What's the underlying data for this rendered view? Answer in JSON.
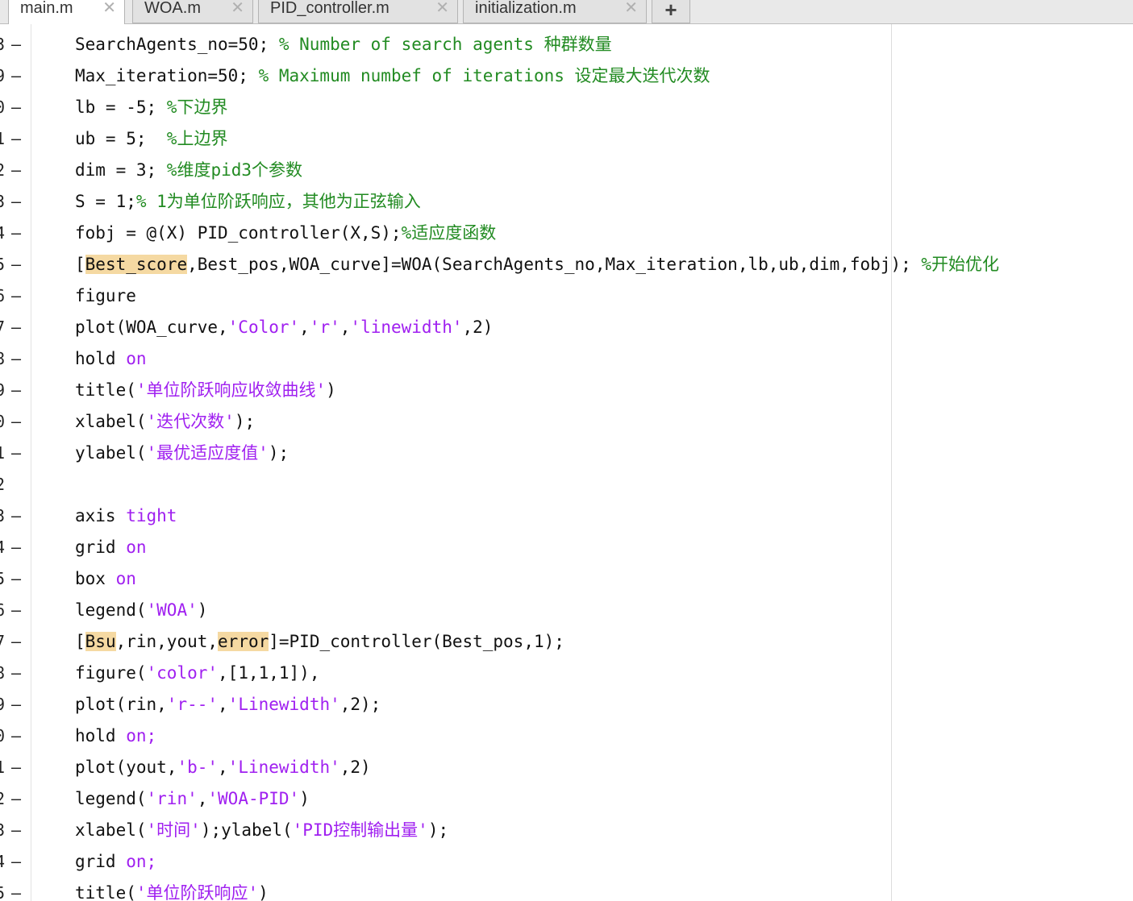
{
  "tabs": [
    {
      "label": "main.m",
      "active": true
    },
    {
      "label": "WOA.m",
      "active": false
    },
    {
      "label": "PID_controller.m",
      "active": false
    },
    {
      "label": "initialization.m",
      "active": false
    }
  ],
  "close_glyph": "✕",
  "add_tab_glyph": "+",
  "colors": {
    "comment": "#228b22",
    "string": "#a020f0",
    "keyword": "#a020f0",
    "highlight": "#f5d9a2"
  },
  "lines": [
    {
      "n": "3",
      "dash": "—",
      "segs": [
        [
          "SearchAgents_no=50; ",
          "p"
        ],
        [
          "% Number of search agents 种群数量",
          "c"
        ]
      ]
    },
    {
      "n": "9",
      "dash": "—",
      "segs": [
        [
          "Max_iteration=50; ",
          "p"
        ],
        [
          "% Maximum numbef of iterations 设定最大迭代次数",
          "c"
        ]
      ]
    },
    {
      "n": "0",
      "dash": "—",
      "segs": [
        [
          "lb = -5; ",
          "p"
        ],
        [
          "%下边界",
          "c"
        ]
      ]
    },
    {
      "n": "1",
      "dash": "—",
      "segs": [
        [
          "ub = 5;  ",
          "p"
        ],
        [
          "%上边界",
          "c"
        ]
      ]
    },
    {
      "n": "2",
      "dash": "—",
      "segs": [
        [
          "dim = 3; ",
          "p"
        ],
        [
          "%维度pid3个参数",
          "c"
        ]
      ]
    },
    {
      "n": "3",
      "dash": "—",
      "segs": [
        [
          "S = 1;",
          "p"
        ],
        [
          "% 1为单位阶跃响应，其他为正弦输入",
          "c"
        ]
      ]
    },
    {
      "n": "4",
      "dash": "—",
      "segs": [
        [
          "fobj = @(X) PID_controller(X,S);",
          "p"
        ],
        [
          "%适应度函数",
          "c"
        ]
      ]
    },
    {
      "n": "5",
      "dash": "—",
      "segs": [
        [
          "[",
          "p"
        ],
        [
          "Best_score",
          "h"
        ],
        [
          ",Best_pos,WOA_curve]=WOA(SearchAgents_no,Max_iteration,lb,ub,dim,fobj); ",
          "p"
        ],
        [
          "%开始优化",
          "c"
        ]
      ]
    },
    {
      "n": "6",
      "dash": "—",
      "segs": [
        [
          "figure",
          "p"
        ]
      ]
    },
    {
      "n": "7",
      "dash": "—",
      "segs": [
        [
          "plot(WOA_curve,",
          "p"
        ],
        [
          "'Color'",
          "s"
        ],
        [
          ",",
          "p"
        ],
        [
          "'r'",
          "s"
        ],
        [
          ",",
          "p"
        ],
        [
          "'linewidth'",
          "s"
        ],
        [
          ",2)",
          "p"
        ]
      ]
    },
    {
      "n": "8",
      "dash": "—",
      "segs": [
        [
          "hold ",
          "p"
        ],
        [
          "on",
          "s"
        ]
      ]
    },
    {
      "n": "9",
      "dash": "—",
      "segs": [
        [
          "title(",
          "p"
        ],
        [
          "'单位阶跃响应收敛曲线'",
          "s"
        ],
        [
          ")",
          "p"
        ]
      ]
    },
    {
      "n": "0",
      "dash": "—",
      "segs": [
        [
          "xlabel(",
          "p"
        ],
        [
          "'迭代次数'",
          "s"
        ],
        [
          ");",
          "p"
        ]
      ]
    },
    {
      "n": "1",
      "dash": "—",
      "segs": [
        [
          "ylabel(",
          "p"
        ],
        [
          "'最优适应度值'",
          "s"
        ],
        [
          ");",
          "p"
        ]
      ]
    },
    {
      "n": "2",
      "dash": "",
      "segs": []
    },
    {
      "n": "3",
      "dash": "—",
      "segs": [
        [
          "axis ",
          "p"
        ],
        [
          "tight",
          "s"
        ]
      ]
    },
    {
      "n": "4",
      "dash": "—",
      "segs": [
        [
          "grid ",
          "p"
        ],
        [
          "on",
          "s"
        ]
      ]
    },
    {
      "n": "5",
      "dash": "—",
      "segs": [
        [
          "box ",
          "p"
        ],
        [
          "on",
          "s"
        ]
      ]
    },
    {
      "n": "6",
      "dash": "—",
      "segs": [
        [
          "legend(",
          "p"
        ],
        [
          "'WOA'",
          "s"
        ],
        [
          ")",
          "p"
        ]
      ]
    },
    {
      "n": "7",
      "dash": "—",
      "segs": [
        [
          "[",
          "p"
        ],
        [
          "Bsu",
          "h"
        ],
        [
          ",rin,yout,",
          "p"
        ],
        [
          "error",
          "h"
        ],
        [
          "]=PID_controller(Best_pos,1);",
          "p"
        ]
      ]
    },
    {
      "n": "8",
      "dash": "—",
      "segs": [
        [
          "figure(",
          "p"
        ],
        [
          "'color'",
          "s"
        ],
        [
          ",[1,1,1]),",
          "p"
        ]
      ]
    },
    {
      "n": "9",
      "dash": "—",
      "segs": [
        [
          "plot(rin,",
          "p"
        ],
        [
          "'r--'",
          "s"
        ],
        [
          ",",
          "p"
        ],
        [
          "'Linewidth'",
          "s"
        ],
        [
          ",2);",
          "p"
        ]
      ]
    },
    {
      "n": "0",
      "dash": "—",
      "segs": [
        [
          "hold ",
          "p"
        ],
        [
          "on;",
          "s"
        ]
      ]
    },
    {
      "n": "1",
      "dash": "—",
      "segs": [
        [
          "plot(yout,",
          "p"
        ],
        [
          "'b-'",
          "s"
        ],
        [
          ",",
          "p"
        ],
        [
          "'Linewidth'",
          "s"
        ],
        [
          ",2)",
          "p"
        ]
      ]
    },
    {
      "n": "2",
      "dash": "—",
      "segs": [
        [
          "legend(",
          "p"
        ],
        [
          "'rin'",
          "s"
        ],
        [
          ",",
          "p"
        ],
        [
          "'WOA-PID'",
          "s"
        ],
        [
          ")",
          "p"
        ]
      ]
    },
    {
      "n": "3",
      "dash": "—",
      "segs": [
        [
          "xlabel(",
          "p"
        ],
        [
          "'时间'",
          "s"
        ],
        [
          ");ylabel(",
          "p"
        ],
        [
          "'PID控制输出量'",
          "s"
        ],
        [
          ");",
          "p"
        ]
      ]
    },
    {
      "n": "4",
      "dash": "—",
      "segs": [
        [
          "grid ",
          "p"
        ],
        [
          "on;",
          "s"
        ]
      ]
    },
    {
      "n": "5",
      "dash": "—",
      "segs": [
        [
          "title(",
          "p"
        ],
        [
          "'单位阶跃响应'",
          "s"
        ],
        [
          ")",
          "p"
        ]
      ]
    }
  ]
}
